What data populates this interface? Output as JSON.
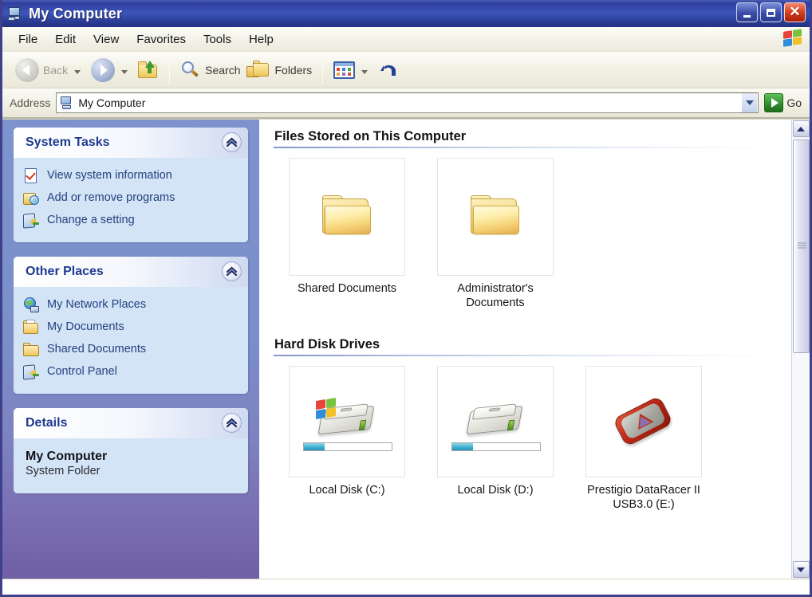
{
  "window": {
    "title": "My Computer",
    "title_icon": "my-computer-icon",
    "controls": {
      "minimize": "minimize-button",
      "maximize": "maximize-button",
      "close_label": "✕"
    }
  },
  "menubar": {
    "items": [
      {
        "label": "File"
      },
      {
        "label": "Edit"
      },
      {
        "label": "View"
      },
      {
        "label": "Favorites"
      },
      {
        "label": "Tools"
      },
      {
        "label": "Help"
      }
    ],
    "logo": "windows-flag-icon"
  },
  "toolbar": {
    "back_label": "Back",
    "forward_label": "",
    "up_icon": "up-folder-icon",
    "search_label": "Search",
    "folders_label": "Folders",
    "views_icon": "views-icon",
    "undo_icon": "undo-icon"
  },
  "address": {
    "label": "Address",
    "value": "My Computer",
    "icon": "my-computer-icon",
    "go_label": "Go"
  },
  "sidebar": {
    "panels": [
      {
        "title": "System Tasks",
        "collapse_icon": "chevron-up-icon",
        "items": [
          {
            "label": "View system information",
            "icon": "system-information-icon"
          },
          {
            "label": "Add or remove programs",
            "icon": "add-remove-programs-icon"
          },
          {
            "label": "Change a setting",
            "icon": "change-setting-icon"
          }
        ]
      },
      {
        "title": "Other Places",
        "collapse_icon": "chevron-up-icon",
        "items": [
          {
            "label": "My Network Places",
            "icon": "network-places-icon"
          },
          {
            "label": "My Documents",
            "icon": "my-documents-icon"
          },
          {
            "label": "Shared Documents",
            "icon": "shared-documents-icon"
          },
          {
            "label": "Control Panel",
            "icon": "control-panel-icon"
          }
        ]
      }
    ],
    "details": {
      "title": "Details",
      "collapse_icon": "chevron-up-icon",
      "name": "My Computer",
      "type": "System Folder"
    }
  },
  "main": {
    "groups": [
      {
        "header": "Files Stored on This Computer",
        "items": [
          {
            "label": "Shared Documents",
            "icon": "folder-icon"
          },
          {
            "label": "Administrator's Documents",
            "icon": "folder-icon"
          }
        ]
      },
      {
        "header": "Hard Disk Drives",
        "items": [
          {
            "label": "Local Disk (C:)",
            "icon": "system-hard-drive-icon",
            "capacity_percent": 24
          },
          {
            "label": "Local Disk (D:)",
            "icon": "hard-drive-icon",
            "capacity_percent": 24
          },
          {
            "label": "Prestigio DataRacer II USB3.0 (E:)",
            "icon": "usb-external-drive-icon",
            "capacity_percent": 0
          }
        ]
      }
    ]
  },
  "scrollbar": {
    "up_icon": "scroll-up-arrow-icon",
    "down_icon": "scroll-down-arrow-icon"
  },
  "colors": {
    "titlebar_blue": "#2f3f9e",
    "sidebar_blue": "#7a8fca",
    "panel_body_blue": "#d4e4f7",
    "panel_title_blue": "#1f3a8f",
    "link_blue": "#24417d",
    "close_red": "#d8411c",
    "go_green": "#2f8a2c"
  }
}
